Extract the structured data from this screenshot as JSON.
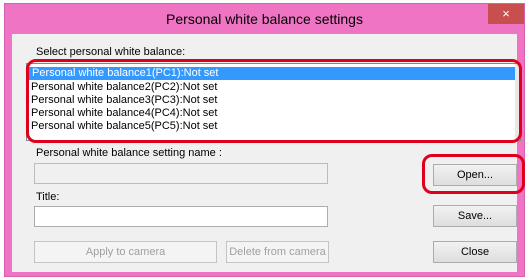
{
  "window": {
    "title": "Personal white balance settings",
    "close_glyph": "×"
  },
  "list": {
    "label": "Select personal white balance:",
    "items": [
      "Personal white balance1(PC1):Not set",
      "Personal white balance2(PC2):Not set",
      "Personal white balance3(PC3):Not set",
      "Personal white balance4(PC4):Not set",
      "Personal white balance5(PC5):Not set"
    ]
  },
  "setting_name": {
    "label": "Personal white balance setting name :",
    "value": ""
  },
  "title_field": {
    "label": "Title:",
    "value": ""
  },
  "buttons": {
    "open": "Open...",
    "save": "Save...",
    "apply": "Apply to camera",
    "delete": "Delete from camera",
    "close": "Close"
  },
  "colors": {
    "title_bar": "#f074c4",
    "selection": "#3399ff",
    "highlight": "#e0001b"
  }
}
